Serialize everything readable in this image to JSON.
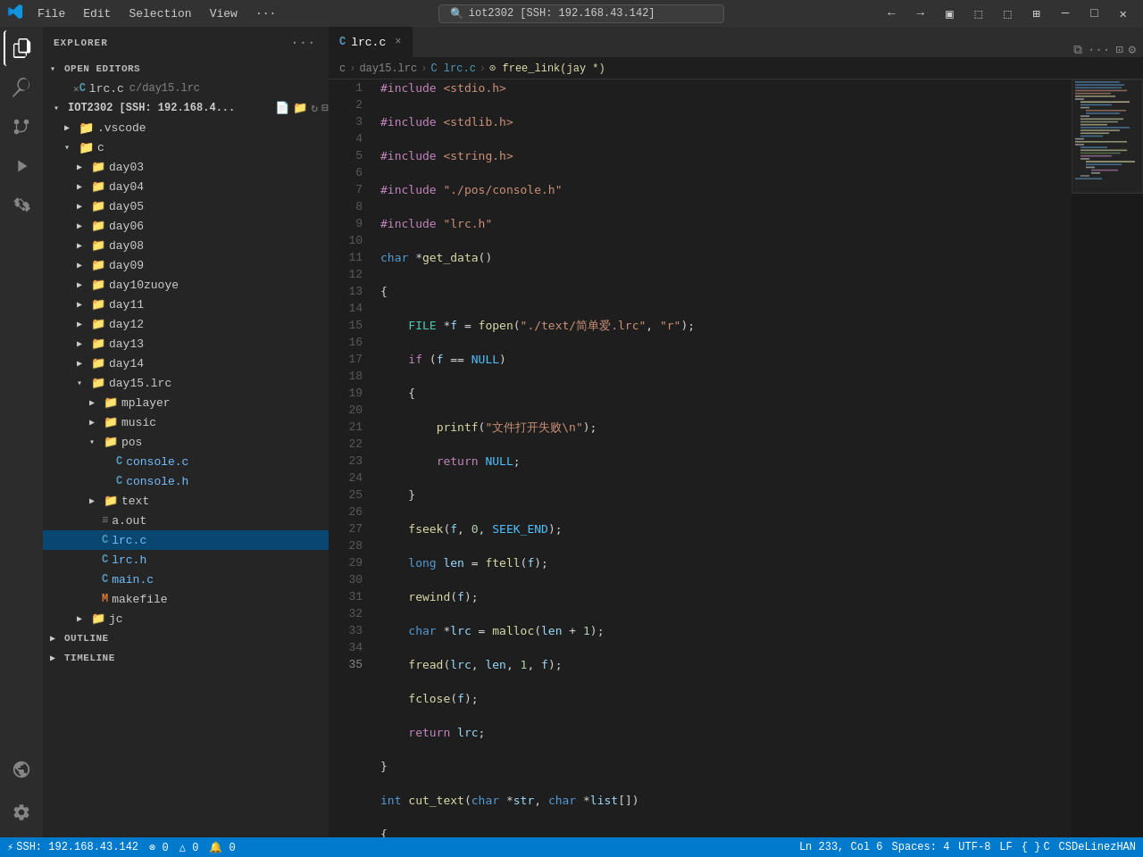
{
  "titlebar": {
    "logo": "VS",
    "menus": [
      "File",
      "Edit",
      "Selection",
      "View",
      "···"
    ],
    "search_text": "iot2302 [SSH: 192.168.43.142]",
    "search_icon": "🔍",
    "controls": [
      "⊟",
      "⧠",
      "❐",
      "⊠",
      "✕"
    ]
  },
  "activity_bar": {
    "icons": [
      "files",
      "search",
      "source-control",
      "run",
      "extensions",
      "remote",
      "settings"
    ]
  },
  "sidebar": {
    "title": "EXPLORER",
    "open_editors_label": "OPEN EDITORS",
    "open_editors": [
      {
        "name": "lrc.c",
        "path": "c/day15.lrc",
        "icon": "C"
      }
    ],
    "workspace": "IOT2302 [SSH: 192.168.4...",
    "tree": [
      {
        "name": ".vscode",
        "type": "folder",
        "depth": 1
      },
      {
        "name": "c",
        "type": "folder",
        "depth": 1,
        "expanded": true
      },
      {
        "name": "day03",
        "type": "folder",
        "depth": 2
      },
      {
        "name": "day04",
        "type": "folder",
        "depth": 2
      },
      {
        "name": "day05",
        "type": "folder",
        "depth": 2
      },
      {
        "name": "day06",
        "type": "folder",
        "depth": 2
      },
      {
        "name": "day08",
        "type": "folder",
        "depth": 2
      },
      {
        "name": "day09",
        "type": "folder",
        "depth": 2
      },
      {
        "name": "day10zuoye",
        "type": "folder",
        "depth": 2
      },
      {
        "name": "day11",
        "type": "folder",
        "depth": 2
      },
      {
        "name": "day12",
        "type": "folder",
        "depth": 2
      },
      {
        "name": "day13",
        "type": "folder",
        "depth": 2
      },
      {
        "name": "day14",
        "type": "folder",
        "depth": 2
      },
      {
        "name": "day15.lrc",
        "type": "folder",
        "depth": 2,
        "expanded": true
      },
      {
        "name": "mplayer",
        "type": "folder",
        "depth": 3
      },
      {
        "name": "music",
        "type": "folder",
        "depth": 3
      },
      {
        "name": "pos",
        "type": "folder",
        "depth": 3,
        "expanded": true
      },
      {
        "name": "console.c",
        "type": "c-file",
        "depth": 4
      },
      {
        "name": "console.h",
        "type": "h-file",
        "depth": 4
      },
      {
        "name": "text",
        "type": "folder",
        "depth": 3
      },
      {
        "name": "a.out",
        "type": "binary",
        "depth": 3
      },
      {
        "name": "lrc.c",
        "type": "c-file",
        "depth": 3,
        "selected": true
      },
      {
        "name": "lrc.h",
        "type": "h-file",
        "depth": 3
      },
      {
        "name": "main.c",
        "type": "c-file",
        "depth": 3
      },
      {
        "name": "makefile",
        "type": "makefile",
        "depth": 3
      },
      {
        "name": "jc",
        "type": "folder",
        "depth": 2
      }
    ],
    "outline_label": "OUTLINE",
    "timeline_label": "TIMELINE"
  },
  "tab": {
    "icon": "C",
    "name": "lrc.c",
    "close": "×"
  },
  "breadcrumb": {
    "parts": [
      "c",
      "day15.lrc",
      "lrc.c",
      "free_link(jay *)"
    ]
  },
  "status": {
    "ssh": "SSH: 192.168.43.142",
    "errors": "⊗ 0",
    "warnings": "△ 0",
    "info": "🔔 0",
    "position": "Ln 233, Col 6",
    "spaces": "Spaces: 4",
    "encoding": "UTF-8",
    "eol": "LF",
    "language": "C",
    "remote": "CSDeLinezHAN"
  }
}
